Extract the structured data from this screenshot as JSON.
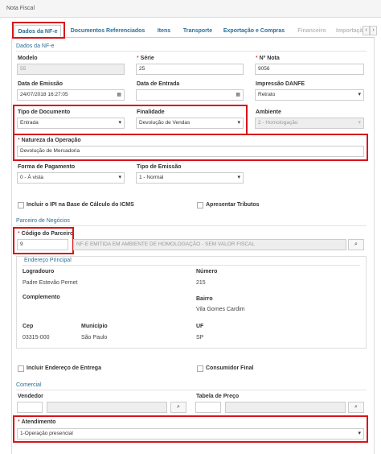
{
  "window": {
    "title": "Nota Fiscal"
  },
  "tabs": [
    {
      "label": "Dados da NF-e"
    },
    {
      "label": "Documentos Referenciados"
    },
    {
      "label": "Itens"
    },
    {
      "label": "Transporte"
    },
    {
      "label": "Exportação e Compras"
    },
    {
      "label": "Financeiro"
    },
    {
      "label": "Importação"
    }
  ],
  "tab_nav": {
    "prev": "‹",
    "next": "›"
  },
  "dados": {
    "section_title": "Dados da NF-e",
    "modelo": {
      "label": "Modelo",
      "value": "55"
    },
    "serie": {
      "label": "Série",
      "value": "25"
    },
    "numero": {
      "label": "Nº Nota",
      "value": "9056"
    },
    "data_emissao": {
      "label": "Data de Emissão",
      "value": "24/07/2018 16:27:05"
    },
    "data_entrada": {
      "label": "Data de Entrada",
      "value": ""
    },
    "impressao_danfe": {
      "label": "Impressão DANFE",
      "value": "Retrato"
    },
    "tipo_documento": {
      "label": "Tipo de Documento",
      "value": "Entrada"
    },
    "finalidade": {
      "label": "Finalidade",
      "value": "Devolução de Vendas"
    },
    "ambiente": {
      "label": "Ambiente",
      "value": "2 - Homologação"
    },
    "natureza": {
      "label": "Natureza da Operação",
      "value": "Devolução de Mercadoria"
    },
    "forma_pagamento": {
      "label": "Forma de Pagamento",
      "value": "0 - À vista"
    },
    "tipo_emissao": {
      "label": "Tipo de Emissão",
      "value": "1 - Normal"
    },
    "incluir_ipi": {
      "label": "Incluir o IPI na Base de Cálculo do ICMS"
    },
    "apresentar_tributos": {
      "label": "Apresentar Tributos"
    }
  },
  "parceiro": {
    "section_title": "Parceiro de Negócios",
    "codigo": {
      "label": "Código do Parceiro",
      "value": "9"
    },
    "nome": "NF-E EMITIDA EM AMBIENTE DE HOMOLOGAÇÃO - SEM VALOR FISCAL",
    "search_icon": "⌕",
    "endereco": {
      "title": "Endereço Principal",
      "logradouro": {
        "label": "Logradouro",
        "value": "Padre Estevão Pernet"
      },
      "numero": {
        "label": "Número",
        "value": "215"
      },
      "complemento": {
        "label": "Complemento",
        "value": ""
      },
      "bairro": {
        "label": "Bairro",
        "value": "Vila Gomes Cardim"
      },
      "cep": {
        "label": "Cep",
        "value": "03315-000"
      },
      "municipio": {
        "label": "Município",
        "value": "São Paulo"
      },
      "uf": {
        "label": "UF",
        "value": "SP"
      }
    },
    "incluir_endereco_entrega": {
      "label": "Incluir Endereço de Entrega"
    },
    "consumidor_final": {
      "label": "Consumidor Final"
    }
  },
  "comercial": {
    "section_title": "Comercial",
    "vendedor": {
      "label": "Vendedor",
      "value": ""
    },
    "tabela_preco": {
      "label": "Tabela de Preço",
      "value": ""
    },
    "atendimento": {
      "label": "Atendimento",
      "value": "1-Operação presencial"
    }
  },
  "colors": {
    "accent": "#2a6f97",
    "highlight": "#d7141a"
  }
}
